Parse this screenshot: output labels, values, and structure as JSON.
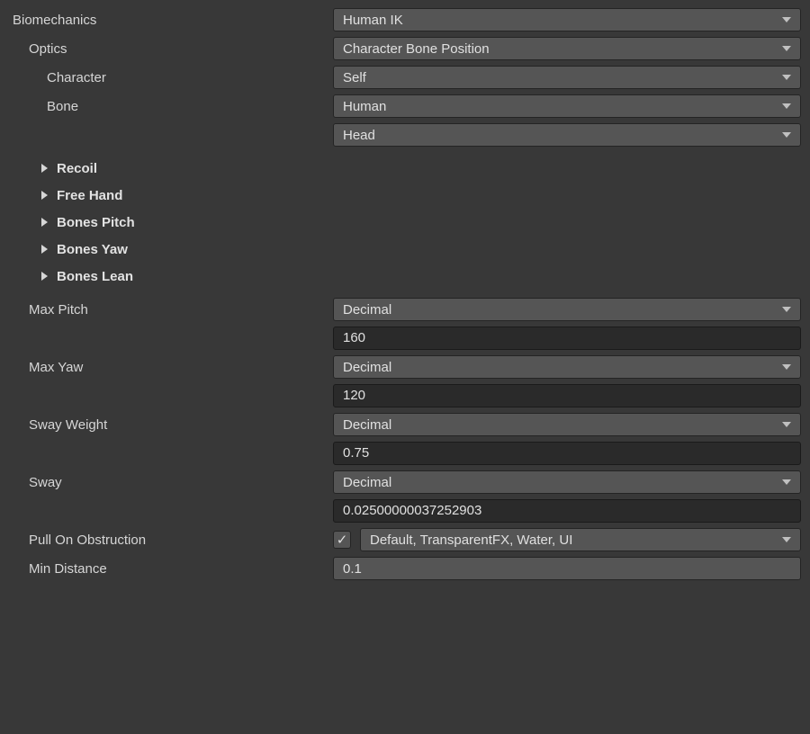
{
  "biomechanics": {
    "label": "Biomechanics",
    "value": "Human IK"
  },
  "optics": {
    "label": "Optics",
    "value": "Character Bone Position",
    "character": {
      "label": "Character",
      "value": "Self"
    },
    "bone": {
      "label": "Bone",
      "value": "Human",
      "value2": "Head"
    }
  },
  "foldouts": [
    {
      "label": "Recoil"
    },
    {
      "label": "Free Hand"
    },
    {
      "label": "Bones Pitch"
    },
    {
      "label": "Bones Yaw"
    },
    {
      "label": "Bones Lean"
    }
  ],
  "maxPitch": {
    "label": "Max Pitch",
    "type": "Decimal",
    "value": "160"
  },
  "maxYaw": {
    "label": "Max Yaw",
    "type": "Decimal",
    "value": "120"
  },
  "swayWeight": {
    "label": "Sway Weight",
    "type": "Decimal",
    "value": "0.75"
  },
  "sway": {
    "label": "Sway",
    "type": "Decimal",
    "value": "0.02500000037252903"
  },
  "pullOnObstruction": {
    "label": "Pull On Obstruction",
    "checked": true,
    "check_glyph": "✓",
    "value": "Default, TransparentFX, Water, UI"
  },
  "minDistance": {
    "label": "Min Distance",
    "value": "0.1"
  }
}
